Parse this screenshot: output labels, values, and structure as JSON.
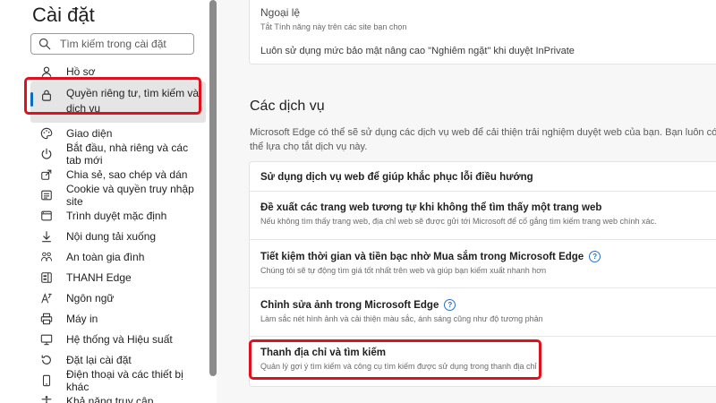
{
  "sidebar": {
    "title": "Cài đặt",
    "search_placeholder": "Tìm kiếm trong cài đặt",
    "items": [
      {
        "label": "Hồ sơ",
        "icon": "profile-icon"
      },
      {
        "label": "Quyền riêng tư, tìm kiếm và dịch vụ",
        "icon": "lock-icon"
      },
      {
        "label": "Giao diện",
        "icon": "appearance-icon"
      },
      {
        "label": "Bắt đầu, nhà riêng và các tab mới",
        "icon": "power-icon"
      },
      {
        "label": "Chia sẻ, sao chép và dán",
        "icon": "share-icon"
      },
      {
        "label": "Cookie và quyền truy nhập site",
        "icon": "site-permissions-icon"
      },
      {
        "label": "Trình duyệt mặc định",
        "icon": "default-browser-icon"
      },
      {
        "label": "Nội dung tải xuống",
        "icon": "download-icon"
      },
      {
        "label": "An toàn gia đình",
        "icon": "family-icon"
      },
      {
        "label": "THANH Edge",
        "icon": "edge-bar-icon"
      },
      {
        "label": "Ngôn ngữ",
        "icon": "language-icon"
      },
      {
        "label": "Máy in",
        "icon": "printer-icon"
      },
      {
        "label": "Hệ thống và Hiệu suất",
        "icon": "system-icon"
      },
      {
        "label": "Đặt lại cài đặt",
        "icon": "reset-icon"
      },
      {
        "label": "Điện thoại và các thiết bị khác",
        "icon": "phone-icon"
      },
      {
        "label": "Khả năng truy cập",
        "icon": "accessibility-icon"
      }
    ]
  },
  "main": {
    "top": {
      "exceptions_title": "Ngoại lệ",
      "exceptions_desc": "Tắt Tính năng này trên các site bạn chọn",
      "strict_label": "Luôn sử dụng mức bảo mật nâng cao \"Nghiêm ngặt\" khi duyệt InPrivate"
    },
    "services": {
      "title": "Các dịch vụ",
      "description": "Microsoft Edge có thể sẽ sử dụng các dịch vụ web để cải thiện trải nghiệm duyệt web của bạn. Bạn luôn có thể lựa chọ tắt dịch vụ này.",
      "items": [
        {
          "title": "Sử dụng dịch vụ web để giúp khắc phục lỗi điều hướng",
          "desc": ""
        },
        {
          "title": "Đề xuất các trang web tương tự khi không thể tìm thấy một trang web",
          "desc": "Nếu không tìm thấy trang web, địa chỉ web sẽ được gửi tới Microsoft để cố gắng tìm kiếm trang web chính xác."
        },
        {
          "title": "Tiết kiệm thời gian và tiền bạc nhờ Mua sắm trong Microsoft Edge",
          "desc": "Chúng tôi sẽ tự động tìm giá tốt nhất trên web và giúp bạn kiếm xuất nhanh hơn"
        },
        {
          "title": "Chỉnh sửa ảnh trong Microsoft Edge",
          "desc": "Làm sắc nét hình ảnh và cải thiện màu sắc, ánh sáng cũng như độ tương phản"
        },
        {
          "title": "Thanh địa chỉ và tìm kiếm",
          "desc": "Quản lý gợi ý tìm kiếm và công cụ tìm kiếm được sử dụng trong thanh địa chỉ"
        }
      ],
      "help_glyph": "?"
    }
  },
  "colors": {
    "accent": "#0f6cbd",
    "highlight": "#e0101c",
    "content_bg": "#f7f7f7"
  }
}
